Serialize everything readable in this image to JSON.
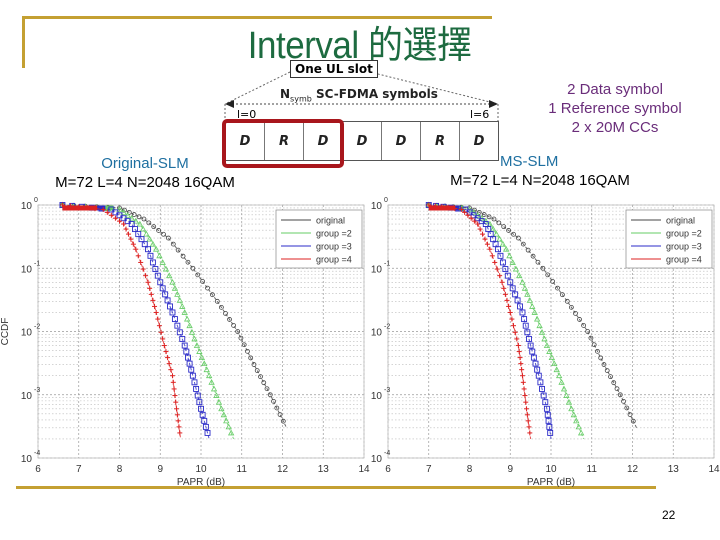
{
  "slide": {
    "title": "Interval 的選擇",
    "page_number": "22",
    "accent_color": "#c4a032",
    "title_color": "#1d6b40"
  },
  "diagram": {
    "slot_label": "One UL slot",
    "symbols_label": "SC-FDMA symbols",
    "nsymb_main": "N",
    "nsymb_sub": "symb",
    "start_index": "l=0",
    "end_index": "l=6",
    "cells": [
      "D",
      "R",
      "D",
      "D",
      "D",
      "R",
      "D"
    ],
    "highlight_cells": 3,
    "highlight_color": "#a8161c"
  },
  "note": {
    "lines": [
      "2 Data symbol",
      "1 Reference symbol",
      "2 x 20M CCs"
    ]
  },
  "left_title": {
    "name": "Original-SLM",
    "params": "M=72 L=4 N=2048 16QAM"
  },
  "right_title": {
    "name": "MS-SLM",
    "params": "M=72 L=4 N=2048 16QAM"
  },
  "chart_data": [
    {
      "type": "line",
      "title": "Original-SLM M=72 L=4 N=2048 16QAM",
      "xlabel": "PAPR (dB)",
      "ylabel": "CCDF",
      "yscale": "log",
      "xlim": [
        6,
        14
      ],
      "ylim": [
        0.0001,
        1
      ],
      "xticks": [
        "6",
        "7",
        "8",
        "9",
        "10",
        "11",
        "12",
        "13",
        "14"
      ],
      "yticks": [
        "10^0",
        "10^-1",
        "10^-2",
        "10^-3",
        "10^-4"
      ],
      "grid": true,
      "legend": "top-right",
      "series": [
        {
          "name": "original",
          "color": "#444444",
          "marker": "o",
          "x": [
            6.6,
            8.0,
            8.6,
            9.2,
            9.8,
            10.4,
            10.9,
            11.3,
            11.7,
            12.1
          ],
          "y": [
            1,
            0.9,
            0.6,
            0.3,
            0.1,
            0.03,
            0.01,
            0.003,
            0.001,
            0.0003
          ]
        },
        {
          "name": "group =2",
          "color": "#66cc66",
          "marker": "^",
          "x": [
            6.6,
            8.0,
            8.5,
            8.9,
            9.3,
            9.6,
            9.9,
            10.2,
            10.5,
            10.8
          ],
          "y": [
            1,
            0.85,
            0.5,
            0.2,
            0.06,
            0.02,
            0.006,
            0.002,
            0.0006,
            0.0002
          ]
        },
        {
          "name": "group =3",
          "color": "#2b2bc8",
          "marker": "s",
          "x": [
            6.6,
            7.8,
            8.3,
            8.7,
            9.0,
            9.3,
            9.6,
            9.8,
            10.0,
            10.2
          ],
          "y": [
            1,
            0.85,
            0.5,
            0.2,
            0.06,
            0.02,
            0.006,
            0.002,
            0.0006,
            0.0002
          ]
        },
        {
          "name": "group =4",
          "color": "#dd2222",
          "marker": "+",
          "x": [
            6.6,
            7.6,
            8.1,
            8.4,
            8.7,
            8.9,
            9.1,
            9.3,
            9.4,
            9.5
          ],
          "y": [
            1,
            0.85,
            0.5,
            0.2,
            0.06,
            0.02,
            0.006,
            0.002,
            0.0006,
            0.0002
          ]
        }
      ]
    },
    {
      "type": "line",
      "title": "MS-SLM M=72 L=4 N=2048 16QAM",
      "xlabel": "PAPR (dB)",
      "ylabel": "",
      "yscale": "log",
      "xlim": [
        6,
        14
      ],
      "ylim": [
        0.0001,
        1
      ],
      "xticks": [
        "6",
        "7",
        "8",
        "9",
        "10",
        "11",
        "12",
        "13",
        "14"
      ],
      "yticks": [
        "10^0",
        "10^-1",
        "10^-2",
        "10^-3",
        "10^-4"
      ],
      "grid": true,
      "legend": "top-right",
      "series": [
        {
          "name": "original",
          "color": "#444444",
          "marker": "o",
          "x": [
            7.0,
            8.0,
            8.6,
            9.2,
            9.8,
            10.4,
            10.9,
            11.3,
            11.7,
            12.1
          ],
          "y": [
            1,
            0.9,
            0.6,
            0.3,
            0.1,
            0.03,
            0.01,
            0.003,
            0.001,
            0.0003
          ]
        },
        {
          "name": "group =2",
          "color": "#66cc66",
          "marker": "^",
          "x": [
            7.0,
            8.0,
            8.5,
            8.9,
            9.3,
            9.6,
            9.9,
            10.2,
            10.5,
            10.8
          ],
          "y": [
            1,
            0.85,
            0.5,
            0.2,
            0.06,
            0.02,
            0.006,
            0.002,
            0.0006,
            0.0002
          ]
        },
        {
          "name": "group =3",
          "color": "#2b2bc8",
          "marker": "s",
          "x": [
            7.0,
            7.9,
            8.4,
            8.7,
            9.0,
            9.3,
            9.5,
            9.7,
            9.9,
            10.0
          ],
          "y": [
            1,
            0.85,
            0.5,
            0.2,
            0.06,
            0.02,
            0.006,
            0.002,
            0.0006,
            0.0002
          ]
        },
        {
          "name": "group =4",
          "color": "#dd2222",
          "marker": "+",
          "x": [
            7.0,
            7.8,
            8.2,
            8.5,
            8.8,
            9.0,
            9.2,
            9.3,
            9.4,
            9.5
          ],
          "y": [
            1,
            0.85,
            0.5,
            0.2,
            0.06,
            0.02,
            0.006,
            0.002,
            0.0006,
            0.0002
          ]
        }
      ]
    }
  ]
}
